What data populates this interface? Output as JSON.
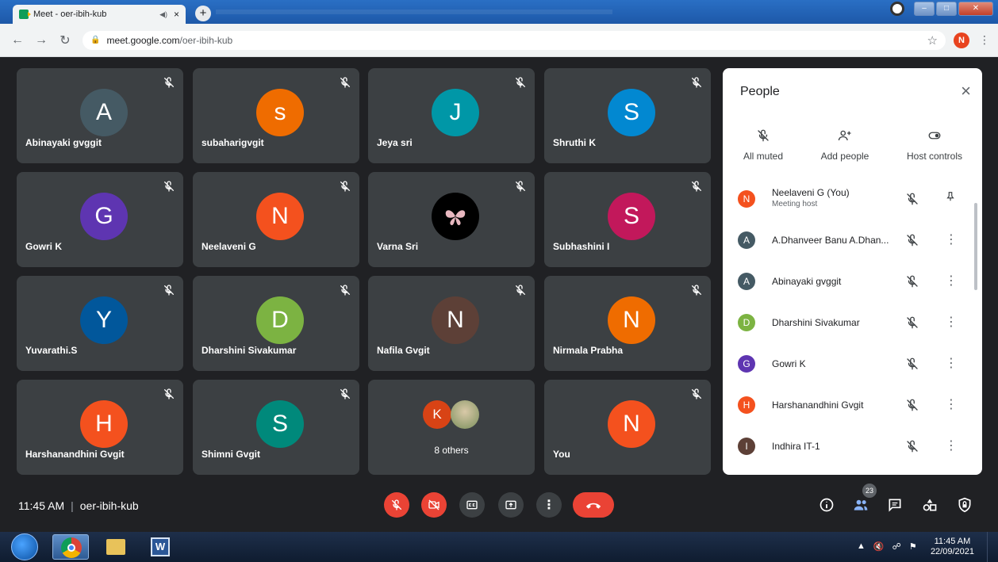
{
  "browser": {
    "tab_title": "Meet - oer-ibih-kub",
    "tab_close": "×",
    "new_tab": "+",
    "url_host": "meet.google.com",
    "url_path": "/oer-ibih-kub",
    "profile_initial": "N"
  },
  "tiles": [
    {
      "name": "Abinayaki gvggit",
      "initial": "A",
      "color": "#455a64"
    },
    {
      "name": "subaharigvgit",
      "initial": "s",
      "color": "#ef6c00"
    },
    {
      "name": "Jeya sri",
      "initial": "J",
      "color": "#0097a7"
    },
    {
      "name": "Shruthi K",
      "initial": "S",
      "color": "#0288d1"
    },
    {
      "name": "Gowri K",
      "initial": "G",
      "color": "#5e35b1"
    },
    {
      "name": "Neelaveni G",
      "initial": "N",
      "color": "#f4511e"
    },
    {
      "name": "Varna Sri",
      "initial": "",
      "color": "#000000"
    },
    {
      "name": "Subhashini I",
      "initial": "S",
      "color": "#c2185b"
    },
    {
      "name": "Yuvarathi.S",
      "initial": "Y",
      "color": "#01579b"
    },
    {
      "name": "Dharshini Sivakumar",
      "initial": "D",
      "color": "#7cb342"
    },
    {
      "name": "Nafila Gvgit",
      "initial": "N",
      "color": "#5d4037"
    },
    {
      "name": "Nirmala Prabha",
      "initial": "N",
      "color": "#ef6c00"
    },
    {
      "name": "Harshanandhini Gvgit",
      "initial": "H",
      "color": "#f4511e"
    },
    {
      "name": "Shimni Gvgit",
      "initial": "S",
      "color": "#00897b"
    },
    {
      "name": "You",
      "initial": "N",
      "color": "#f4511e"
    }
  ],
  "others": {
    "label": "8 others",
    "initial": "K",
    "color": "#d84315"
  },
  "panel": {
    "title": "People",
    "close": "×",
    "actions": {
      "all_muted": "All muted",
      "add_people": "Add people",
      "host_controls": "Host controls"
    },
    "people": [
      {
        "name": "Neelaveni G (You)",
        "sub": "Meeting host",
        "initial": "N",
        "color": "#f4511e"
      },
      {
        "name": "A.Dhanveer Banu A.Dhan...",
        "sub": "",
        "initial": "A",
        "color": "#455a64"
      },
      {
        "name": "Abinayaki gvggit",
        "sub": "",
        "initial": "A",
        "color": "#455a64"
      },
      {
        "name": "Dharshini Sivakumar",
        "sub": "",
        "initial": "D",
        "color": "#7cb342"
      },
      {
        "name": "Gowri K",
        "sub": "",
        "initial": "G",
        "color": "#5e35b1"
      },
      {
        "name": "Harshanandhini Gvgit",
        "sub": "",
        "initial": "H",
        "color": "#f4511e"
      },
      {
        "name": "Indhira IT-1",
        "sub": "",
        "initial": "I",
        "color": "#5d4037"
      }
    ]
  },
  "bottom": {
    "time": "11:45 AM",
    "separator": "|",
    "meeting_code": "oer-ibih-kub",
    "participant_count": "23"
  },
  "taskbar": {
    "time": "11:45 AM",
    "date": "22/09/2021"
  }
}
